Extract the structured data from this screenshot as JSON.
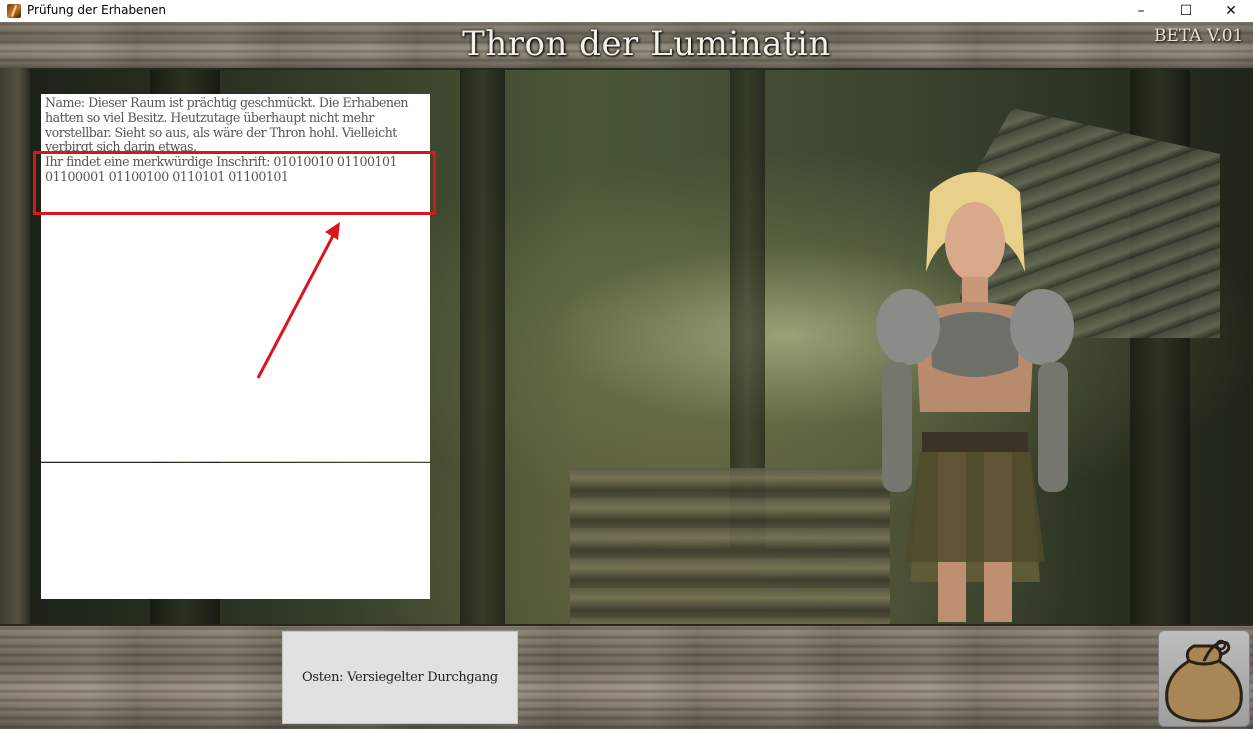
{
  "window": {
    "title": "Prüfung der Erhabenen",
    "minimize_label": "–",
    "maximize_label": "☐",
    "close_label": "✕"
  },
  "game": {
    "room_title": "Thron der Luminatin",
    "version": "BETA V.01",
    "description": "Name: Dieser Raum ist prächtig geschmückt. Die Erhabenen hatten so viel Besitz. Heutzutage überhaupt nicht mehr vorstellbar. Sieht so aus, als wäre der Thron hohl. Vielleicht verbirgt sich darin etwas.\nIhr findet eine merkwürdige Inschrift: 01010010 01100101 01100001 01100100 0110101 01100101",
    "exits": [
      {
        "label": "Osten: Versiegelter Durchgang"
      }
    ],
    "inventory_icon": "sack-icon",
    "annotation_color": "#d9161c"
  }
}
